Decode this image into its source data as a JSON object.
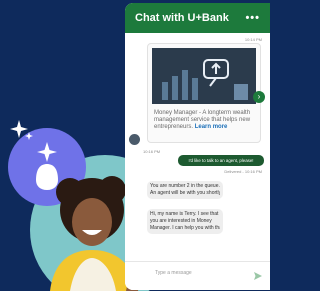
{
  "chat": {
    "title": "Chat with U+Bank",
    "menu_icon": "more-dots-icon",
    "card": {
      "timestamp": "10:14 PM",
      "text": "Money Manager - A longterm wealth management service that helps new entrepreneurs.",
      "link": "Learn more"
    },
    "messages": [
      {
        "from": "bot",
        "timestamp": "10:16 PM"
      },
      {
        "from": "user",
        "text": "I'd like to talk to an agent, please!",
        "status": "Delivered - 10:16 PM"
      },
      {
        "from": "bot",
        "lines": [
          "You are number 2 in the queue.",
          "An agent will be with you shortly."
        ]
      },
      {
        "from": "bot",
        "lines": [
          "Hi, my name is Terry. I see that",
          "you are interested in Money",
          "Manager. I can help you with that."
        ]
      }
    ],
    "input_placeholder": "Type a message"
  },
  "colors": {
    "background": "#0e2a5c",
    "header": "#1d7a3c",
    "user_bubble": "#1d5a30",
    "teal_circle": "#7fc7c9",
    "purple_circle": "#6f72e8"
  },
  "icons": [
    "sparkle-icon",
    "smart-assistant-icon",
    "send-icon",
    "chevron-right-icon",
    "bot-avatar-icon"
  ]
}
